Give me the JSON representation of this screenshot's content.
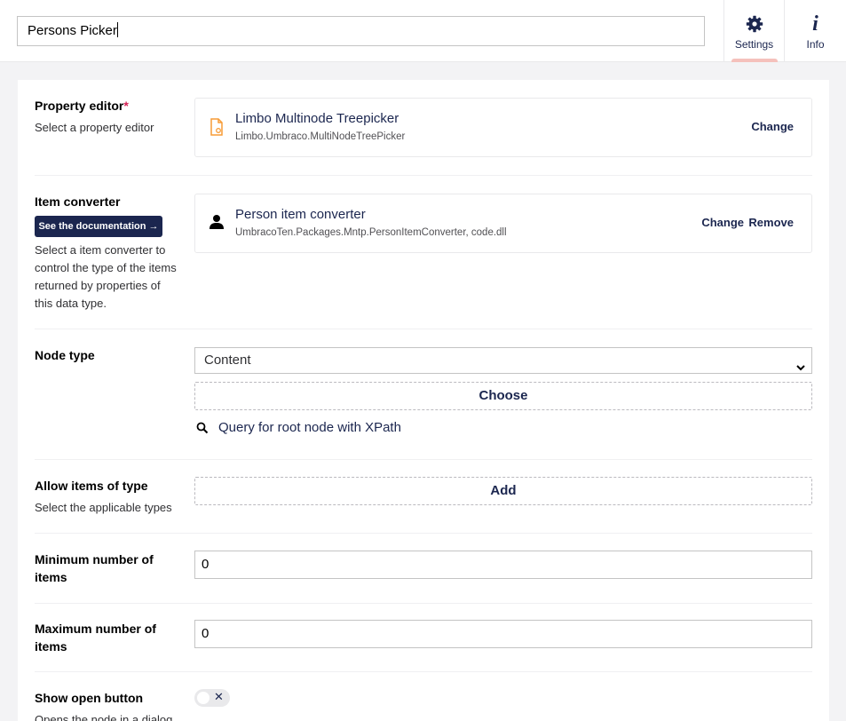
{
  "header": {
    "name_value": "Persons Picker",
    "tabs": [
      {
        "label": "Settings",
        "icon": "gear-icon"
      },
      {
        "label": "Info",
        "icon": "info-icon"
      }
    ]
  },
  "property_editor": {
    "label": "Property editor",
    "required_mark": "*",
    "description": "Select a property editor",
    "name": "Limbo Multinode Treepicker",
    "alias": "Limbo.Umbraco.MultiNodeTreePicker",
    "icon": "document-icon",
    "change_label": "Change"
  },
  "item_converter": {
    "label": "Item converter",
    "doc_button": "See the documentation →",
    "description_lines": [
      "Select a item converter to",
      "control the type of the items",
      "returned by properties of",
      "this data type."
    ],
    "name": "Person item converter",
    "alias": "UmbracoTen.Packages.Mntp.PersonItemConverter, code.dll",
    "icon": "user-icon",
    "change_label": "Change",
    "remove_label": "Remove"
  },
  "node_type": {
    "label": "Node type",
    "selected": "Content",
    "choose_label": "Choose",
    "query_label": "Query for root node with XPath"
  },
  "allow_items": {
    "label": "Allow items of type",
    "description": "Select the applicable types",
    "add_label": "Add"
  },
  "min_items": {
    "label_lines": [
      "Minimum number of",
      "items"
    ],
    "value": "0"
  },
  "max_items": {
    "label_lines": [
      "Maximum number of",
      "items"
    ],
    "value": "0"
  },
  "open_button": {
    "label": "Show open button",
    "description": "Opens the node in a dialog",
    "toggle_symbol": "✕"
  },
  "colors": {
    "navy": "#1b264f",
    "accent_pink": "#f5c1bc",
    "required": "#d42054",
    "doc_icon": "#f79c37"
  }
}
